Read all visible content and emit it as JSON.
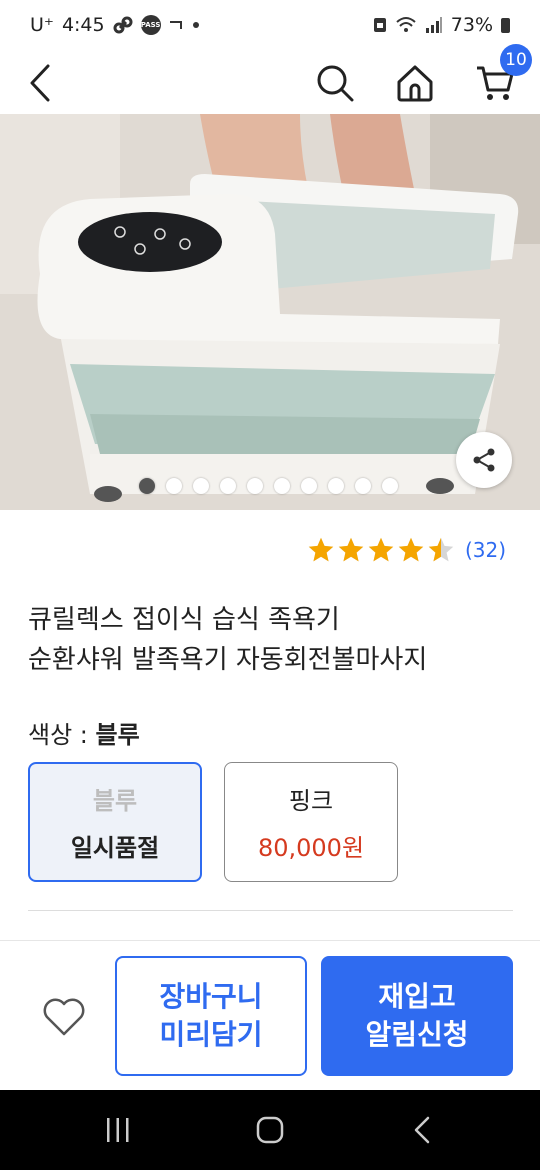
{
  "status_bar": {
    "carrier": "U⁺",
    "time": "4:45",
    "pass_label": "PASS",
    "battery": "73%"
  },
  "nav": {
    "cart_count": "10"
  },
  "gallery": {
    "image_count": 10,
    "active_index": 0
  },
  "rating": {
    "stars": 4.5,
    "count": "(32)",
    "star_color": "#f5a500"
  },
  "product": {
    "title_line1": "큐릴렉스 접이식 습식 족욕기",
    "title_line2": "순환샤워 발족욕기 자동회전볼마사지"
  },
  "color": {
    "label": "색상 : ",
    "selected": "블루",
    "options": [
      {
        "name": "블루",
        "status": "일시품절"
      },
      {
        "name": "핑크",
        "price": "80,000원"
      }
    ]
  },
  "actions": {
    "cart_label": "장바구니\n미리담기",
    "restock_label": "재입고\n알림신청"
  },
  "colors": {
    "accent": "#2f6bf0",
    "price": "#d53a1f"
  }
}
